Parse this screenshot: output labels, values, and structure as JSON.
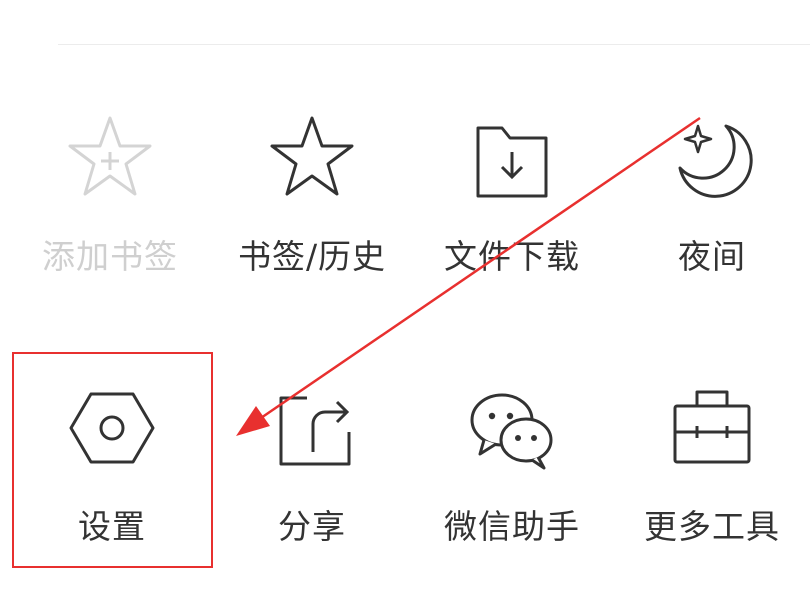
{
  "menu": {
    "row1": [
      {
        "label": "添加书签",
        "icon": "add-bookmark-icon",
        "disabled": true
      },
      {
        "label": "书签/历史",
        "icon": "star-icon"
      },
      {
        "label": "文件下载",
        "icon": "download-folder-icon"
      },
      {
        "label": "夜间",
        "icon": "moon-icon"
      }
    ],
    "row2": [
      {
        "label": "设置",
        "icon": "settings-hexagon-icon"
      },
      {
        "label": "分享",
        "icon": "share-icon"
      },
      {
        "label": "微信助手",
        "icon": "wechat-icon"
      },
      {
        "label": "更多工具",
        "icon": "toolbox-icon"
      }
    ]
  },
  "colors": {
    "icon": "#333333",
    "disabled": "#cfcfcf",
    "annotation": "#e8302f"
  }
}
